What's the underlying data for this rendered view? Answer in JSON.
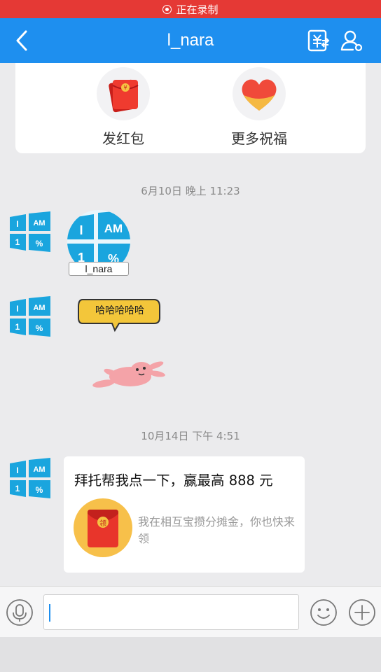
{
  "status_bar": {
    "recording_label": "正在录制"
  },
  "nav": {
    "title": "l_nara"
  },
  "actions": {
    "red_packet_label": "发红包",
    "blessing_label": "更多祝福"
  },
  "messages": [
    {
      "timestamp": "6月10日 晚上 11:23",
      "avatar_text": {
        "i": "I",
        "am": "AM",
        "one": "1",
        "pct": "%"
      },
      "card_name": "l_nara",
      "sticker_text": "哈哈哈哈哈"
    },
    {
      "timestamp": "10月14日 下午 4:51",
      "bubble_title": "拜托帮我点一下，赢最高 888 元",
      "bubble_sub": "我在相互宝攒分摊金，你也快来领",
      "packet_glyph": "领"
    }
  ],
  "input": {
    "placeholder": ""
  },
  "icons": {
    "back": "chevron-left-icon",
    "transfer": "yuan-transfer-icon",
    "profile": "person-icon",
    "mic": "microphone-icon",
    "emoji": "smiley-icon",
    "plus": "plus-icon"
  },
  "colors": {
    "nav": "#1e8fef",
    "record": "#e53935",
    "background": "#ebebed",
    "packet_red": "#e8352b",
    "packet_gold": "#f5c242",
    "heart": "#f04a3a"
  }
}
